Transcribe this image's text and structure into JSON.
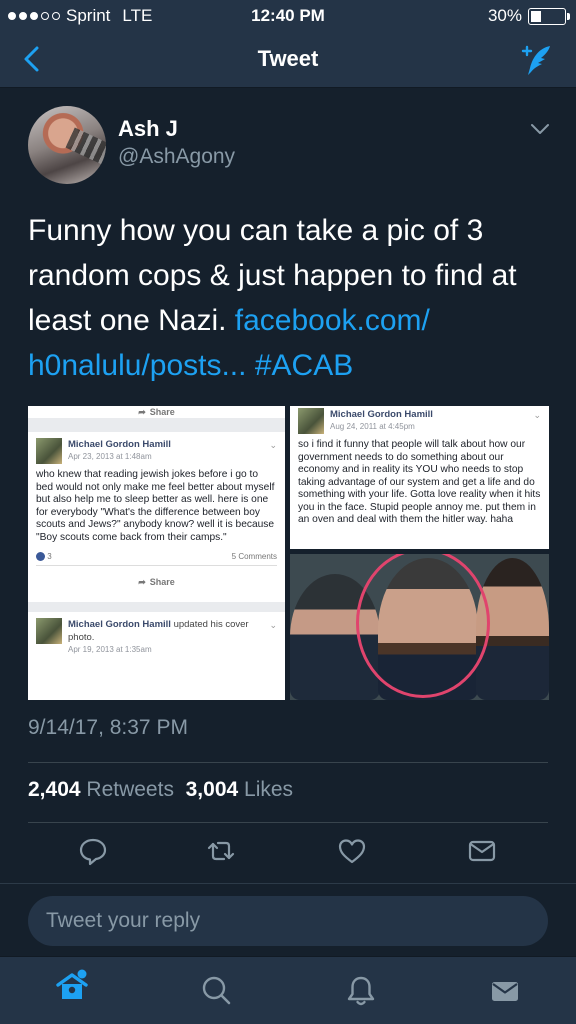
{
  "status_bar": {
    "carrier": "Sprint",
    "network": "LTE",
    "time": "12:40 PM",
    "battery": "30%",
    "battery_level": 0.3
  },
  "nav": {
    "title": "Tweet",
    "back_icon": "chevron-left-icon",
    "compose_icon": "compose-tweet-icon"
  },
  "tweet": {
    "author_name": "Ash J",
    "author_handle": "@AshAgony",
    "text_plain": "Funny how you can take a pic of 3 random cops & just happen to find at least one Nazi. ",
    "link_text": "facebook.com/\nh0nalulu/posts...",
    "hashtag": "#ACAB",
    "timestamp": "9/14/17, 8:37 PM",
    "retweets_count": "2,404",
    "retweets_label": "Retweets",
    "likes_count": "3,004",
    "likes_label": "Likes"
  },
  "media": {
    "left_post": {
      "share_top": "Share",
      "author": "Michael Gordon Hamill",
      "date": "Apr 23, 2013 at 1:48am",
      "body": "who knew that reading jewish jokes before i go to bed would not only make me feel better about myself but also help me to sleep better as well. here is one for everybody \"What's the difference between boy scouts and Jews?\" anybody know? well it is because \"Boy scouts come back from their camps.\"",
      "likes": "3",
      "comments": "5 Comments",
      "share_bottom": "Share",
      "author2": "Michael Gordon Hamill",
      "author2_action": "updated his cover photo.",
      "date2": "Apr 19, 2013 at 1:35am"
    },
    "right_post": {
      "author": "Michael Gordon Hamill",
      "date": "Aug 24, 2011 at 4:45pm",
      "body": "so i find it funny that people will talk about how our government needs to do something about our economy and in reality its YOU who needs to stop taking advantage of our system and get a life and do something with your life. Gotta love reality when it hits you in the face. Stupid people annoy me. put them in an oven and deal with them the hitler way. haha"
    }
  },
  "actions": [
    "reply-icon",
    "retweet-icon",
    "like-heart-icon",
    "direct-message-icon"
  ],
  "reply": {
    "placeholder": "Tweet your reply"
  },
  "tabs": [
    "home-icon",
    "search-icon",
    "notifications-bell-icon",
    "messages-envelope-icon"
  ],
  "colors": {
    "background": "#15202c",
    "bar": "#243447",
    "accent": "#1da1f2",
    "muted": "#8899a6",
    "highlight_circle": "#e0446d"
  }
}
